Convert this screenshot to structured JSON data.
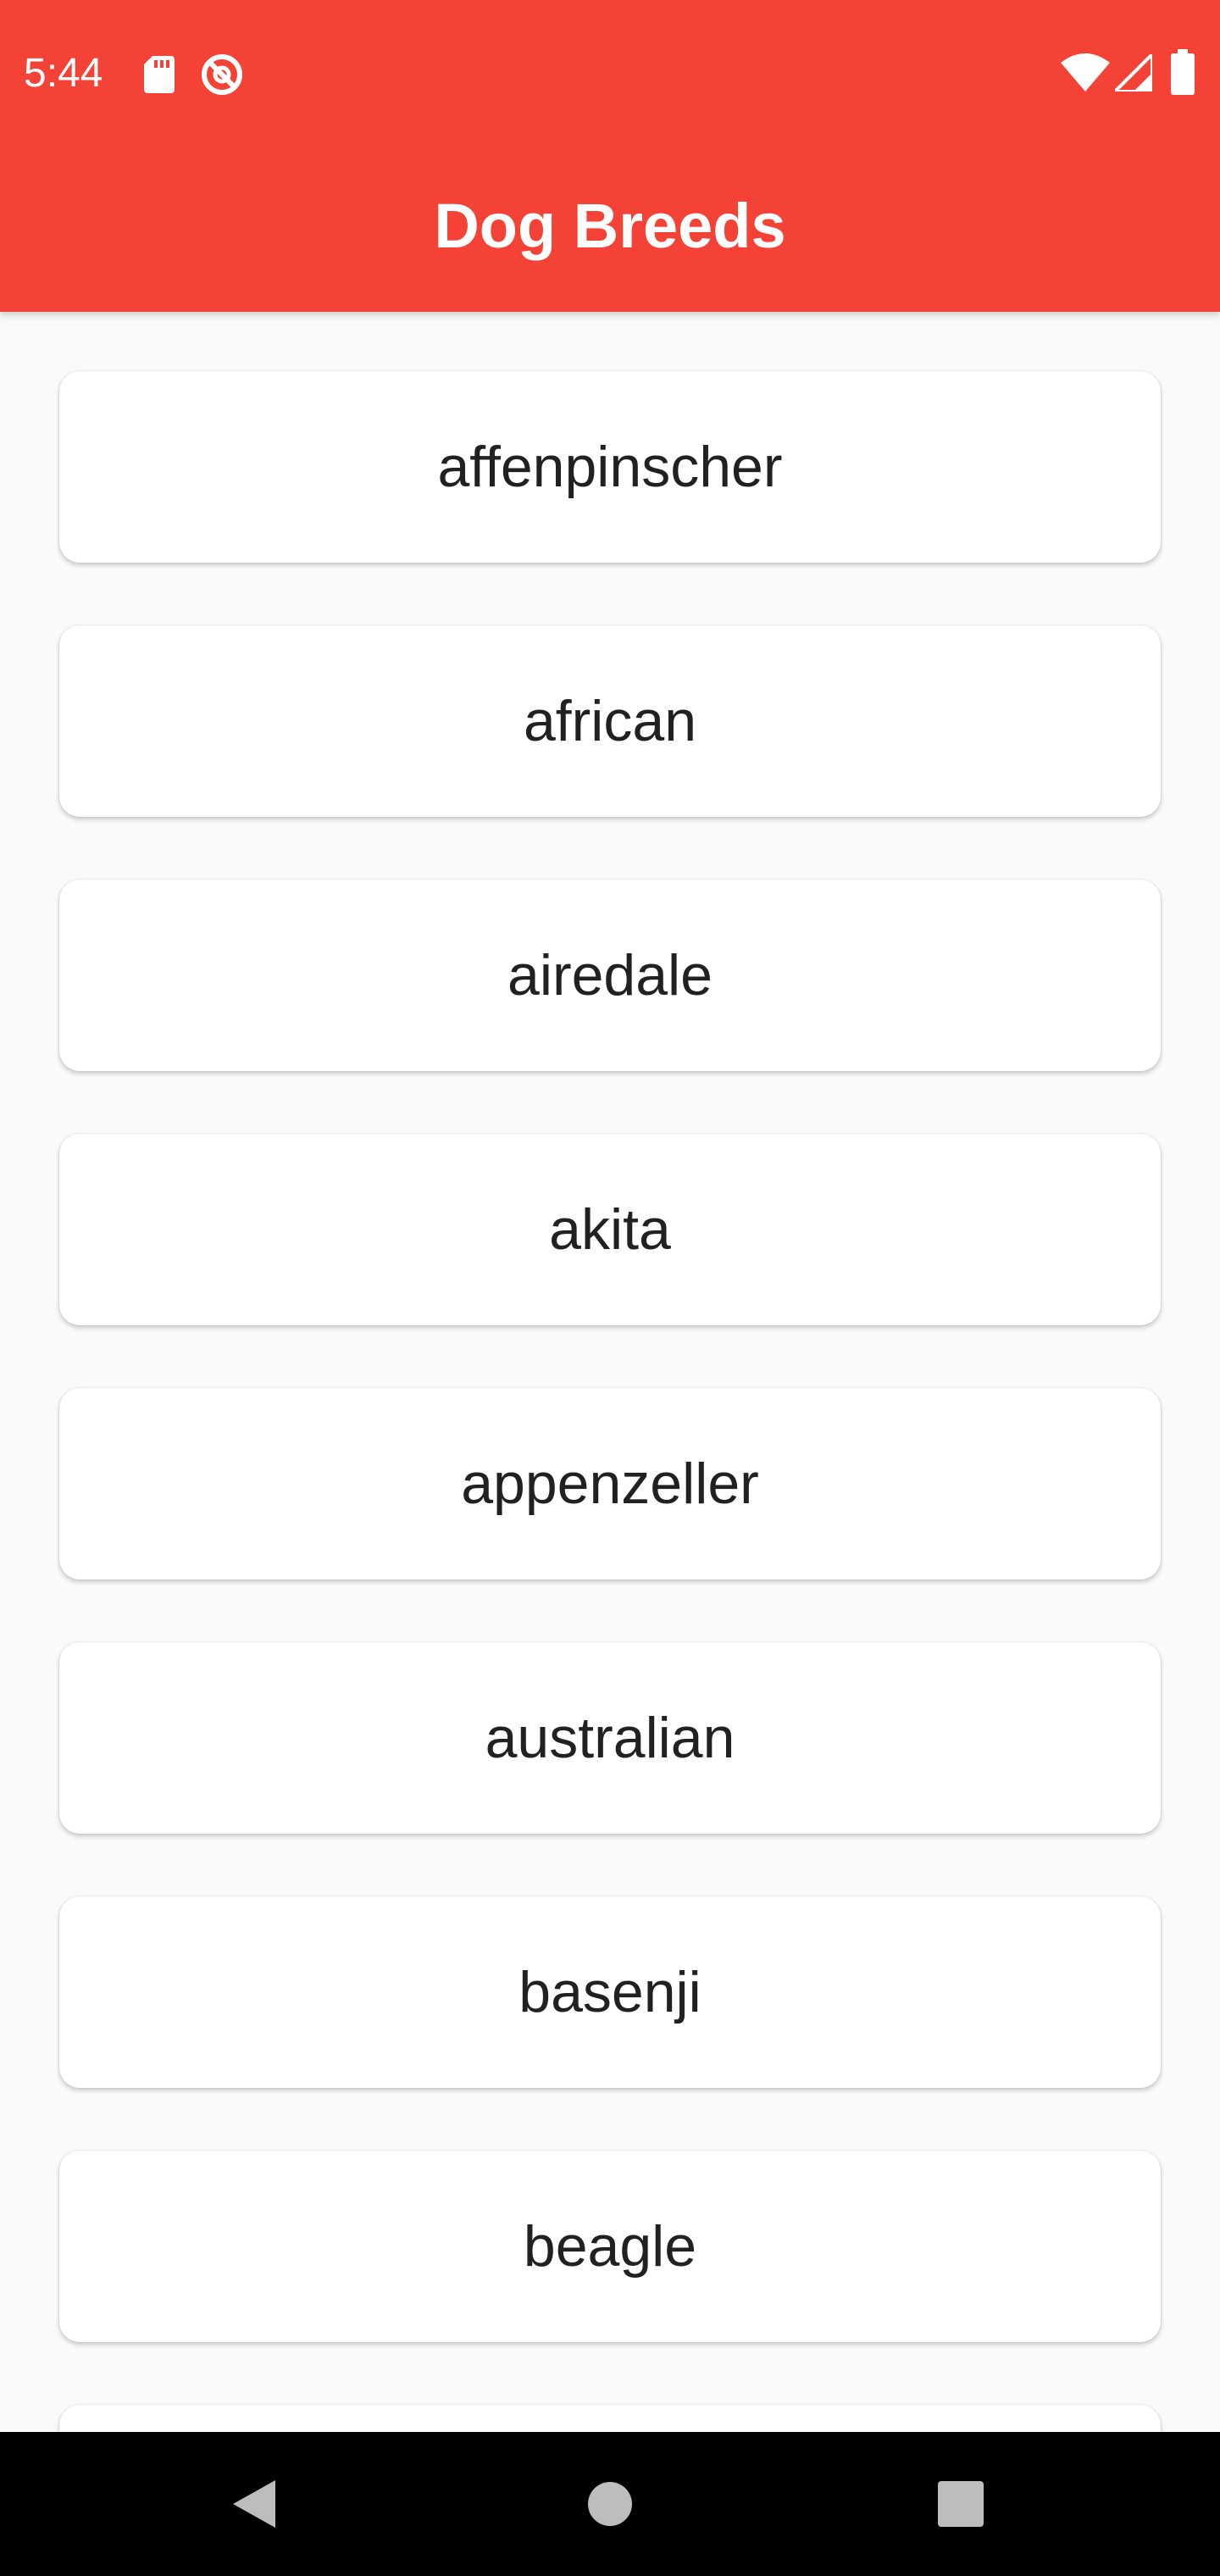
{
  "status_bar": {
    "time": "5:44",
    "icons_left": [
      "sd-card-icon",
      "do-not-disturb-icon"
    ],
    "icons_right": [
      "wifi-icon",
      "cell-signal-icon",
      "battery-icon"
    ]
  },
  "app_bar": {
    "title": "Dog Breeds"
  },
  "breeds": [
    "affenpinscher",
    "african",
    "airedale",
    "akita",
    "appenzeller",
    "australian",
    "basenji",
    "beagle",
    ""
  ],
  "nav_bar": {
    "buttons": [
      "back-icon",
      "home-icon",
      "recents-icon"
    ]
  },
  "colors": {
    "primary": "#f44336",
    "background": "#fafafa",
    "card": "#ffffff",
    "text": "#212121"
  }
}
